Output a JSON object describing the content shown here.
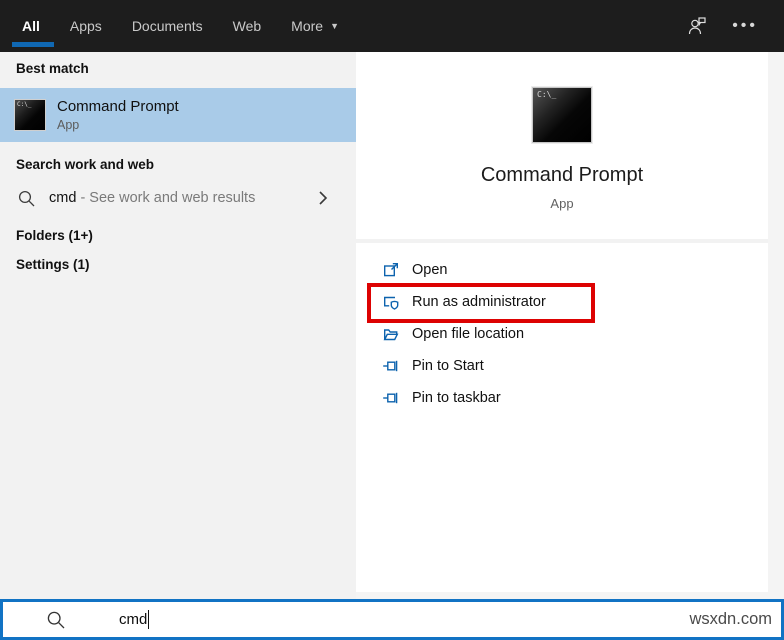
{
  "topbar": {
    "tabs": [
      {
        "label": "All",
        "active": true
      },
      {
        "label": "Apps",
        "active": false
      },
      {
        "label": "Documents",
        "active": false
      },
      {
        "label": "Web",
        "active": false
      },
      {
        "label": "More",
        "active": false,
        "has_dropdown": true
      }
    ],
    "icons": {
      "feedback": "person-feedback-icon",
      "menu": "ellipsis-icon"
    },
    "ellipsis_glyph": "•••"
  },
  "left_panel": {
    "best_match_label": "Best match",
    "best_match_item": {
      "title": "Command Prompt",
      "subtitle": "App",
      "icon": "command-prompt-icon",
      "icon_text": "C:\\_"
    },
    "search_web_label": "Search work and web",
    "web_suggestion": {
      "query": "cmd",
      "hint": "- See work and web results",
      "icon": "search-icon",
      "chevron": "chevron-right-icon"
    },
    "folders_label": "Folders (1+)",
    "settings_label": "Settings (1)"
  },
  "right_panel": {
    "app_title": "Command Prompt",
    "app_subtitle": "App",
    "app_icon_text": "C:\\_",
    "actions": [
      {
        "label": "Open",
        "icon": "open-icon"
      },
      {
        "label": "Run as administrator",
        "icon": "shield-admin-icon",
        "highlighted": true
      },
      {
        "label": "Open file location",
        "icon": "folder-icon"
      },
      {
        "label": "Pin to Start",
        "icon": "pin-icon"
      },
      {
        "label": "Pin to taskbar",
        "icon": "pin-icon"
      }
    ],
    "highlighted_action": "Run as administrator"
  },
  "search_bar": {
    "value": "cmd",
    "icon": "search-icon"
  },
  "watermark": "wsxdn.com",
  "colors": {
    "topbar_bg": "#1d1d1d",
    "accent_underline": "#1068b3",
    "best_match_highlight": "#a9cbe8",
    "action_icon_blue": "#0d63ae",
    "alert_red": "#dd0202",
    "searchbox_border": "#1173c4",
    "left_panel_bg": "#f2f2f2"
  }
}
